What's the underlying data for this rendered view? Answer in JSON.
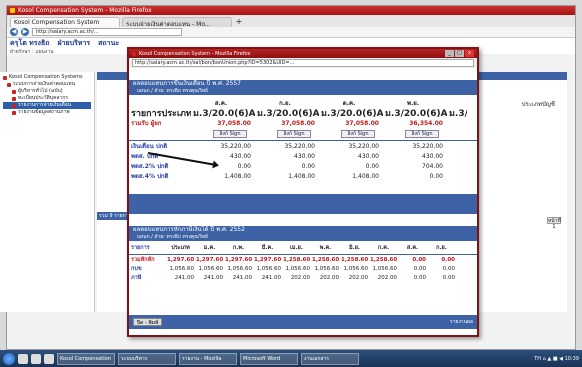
{
  "browser": {
    "title": "Kosol Compensation System - Mozilla Firefox",
    "tabs": [
      "Kosol Compensation System",
      "ระบบจ่ายเงินค่าตอบแทน - Mo..."
    ],
    "url": "http://salary.acm.ac.th/...",
    "site_header": [
      "ครุโต ทรงธิถ",
      "ฝ่ายบริหาร",
      "สถานะ"
    ],
    "site_subheader": "ฝ่ายรักษา : แผนงาน"
  },
  "sidebar": {
    "items": [
      {
        "label": "Kosol Compensation Systems"
      },
      {
        "label": "ระบบการจ่ายเงินค่าตอบแทน"
      },
      {
        "label": "ผู้บริหารทั่วไป (ฉบับ)"
      },
      {
        "label": "ทะเบียนประวัติบุคลากร"
      },
      {
        "label": "รายงานการจ่ายเงินเดือน"
      },
      {
        "label": "รายงานข้อมูลสถานภาพ"
      }
    ]
  },
  "background": {
    "column_label": "ประเภทบัญชี",
    "footer_label": "รวม 9 รายการ",
    "next_button": "หน้าที่ 1"
  },
  "popup": {
    "title": "Kosol Compensation System - Mozilla Firefox",
    "url": "http://salary.acm.ac.th/sal/bon/bonUnion.php?ID=5302&UID=...",
    "window_buttons": [
      "_",
      "□",
      "x"
    ],
    "section1": {
      "title": "ผลตอบแทนการขึ้นเงินเดือน ปี พ.ศ. 2557",
      "subtitle": "แผนก / ฝ่าย: ทรงธิถ ทรงคุณวิทย์",
      "months": [
        "ส.ค.",
        "ก.ย.",
        "ต.ค.",
        "พ.ย."
      ],
      "reg_label": "รายการประเภท",
      "reg_values": [
        "ม.3/20.0(6)AA110",
        "ม.3/20.0(6)AA110",
        "ม.3/20.0(6)AA110",
        "ม.3/20.0(6)AA110",
        "ม.3/20"
      ],
      "totals_label": "รวมรับ",
      "totals_sub": "ผู้ยก",
      "totals": [
        "37,058.00",
        "37,058.00",
        "37,058.00",
        "36,354.00"
      ],
      "sign_button": "ลิงก์ Sign",
      "rows": [
        {
          "group": "เงินเดือน",
          "label": "ปกติ",
          "values": [
            "35,220.00",
            "35,220.00",
            "35,220.00",
            "35,220.00"
          ]
        },
        {
          "group": "พตส.",
          "label": "ปกติ",
          "values": [
            "430.00",
            "430.00",
            "430.00",
            "430.00"
          ]
        },
        {
          "group": "พตส.2%",
          "label": "ปกติ",
          "values": [
            "0.00",
            "0.00",
            "0.00",
            "704.00"
          ]
        },
        {
          "group": "พตส.4%",
          "label": "ปกติ",
          "values": [
            "1,408.00",
            "1,408.00",
            "1,408.00",
            "0.00"
          ]
        }
      ]
    },
    "section2": {
      "title": "ผลตอบแทนการหักภาษีเงินได้ ปี พ.ศ. 2552",
      "subtitle": "แผนก / ฝ่าย: ทรงธิถ ทรงคุณวิทย์",
      "headers": [
        "รายการ",
        "ประเภท",
        "ม.ค.",
        "ก.พ.",
        "มี.ค.",
        "เม.ย.",
        "พ.ค.",
        "มิ.ย.",
        "ก.ค.",
        "ส.ค.",
        "ก.ย."
      ],
      "rows": [
        {
          "label": "รวมหักหัก",
          "sub": "ผู้ยก",
          "values": [
            "1,297.60",
            "1,297.60",
            "1,297.60",
            "1,297.60",
            "1,258.60",
            "1,258.60",
            "1,258.60",
            "1,258.60",
            "0.00",
            "0.00"
          ]
        },
        {
          "label": "กบข",
          "sub": "ปกติ",
          "values": [
            "1,056.60",
            "1,056.60",
            "1,056.60",
            "1,056.60",
            "1,056.60",
            "1,056.60",
            "1,056.60",
            "1,056.60",
            "0.00",
            "0.00"
          ]
        },
        {
          "label": "ภาษี",
          "sub": "ปกติ",
          "values": [
            "241.00",
            "241.00",
            "241.00",
            "241.00",
            "202.00",
            "202.00",
            "202.00",
            "202.00",
            "0.00",
            "0.00"
          ]
        }
      ]
    },
    "footer": {
      "button": "ปิด - พิมพ์",
      "right": "รายงานผล"
    }
  },
  "taskbar": {
    "apps": [
      "Kosol Compensation",
      "ระบบบริหาร",
      "รายงาน - Mozilla",
      "Microsoft Word",
      "งานเอกสาร"
    ],
    "tray": "TH ⌂ ▲ ■ ◀ 10:39"
  }
}
